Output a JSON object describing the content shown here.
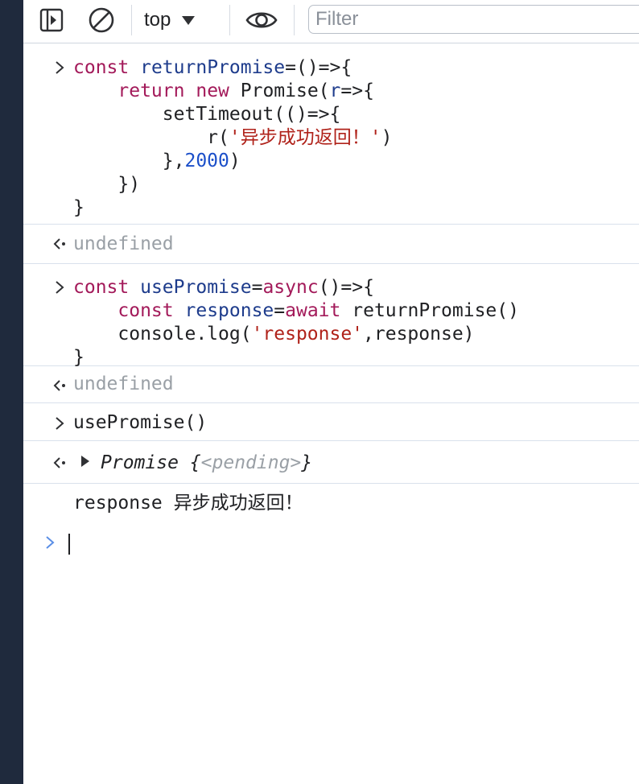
{
  "toolbar": {
    "context_label": "top",
    "filter_placeholder": "Filter",
    "icons": [
      "sidebar-toggle-icon",
      "clear-console-icon",
      "dropdown-triangle-icon",
      "eye-icon"
    ]
  },
  "console": {
    "entries": [
      {
        "kind": "input",
        "lines": [
          [
            "const",
            "returnPromise",
            "=()=>{"
          ],
          [
            "return",
            "new",
            "Promise(",
            "r",
            "=>{"
          ],
          [
            "setTimeout(()=>{"
          ],
          [
            "r(",
            "'异步成功返回！'",
            ")"
          ],
          [
            "},",
            "2000",
            ")"
          ],
          [
            "})"
          ],
          [
            "}"
          ]
        ]
      },
      {
        "kind": "result",
        "text": "undefined"
      },
      {
        "kind": "input",
        "lines": [
          [
            "const",
            "usePromise",
            "=",
            "async",
            "()=>{"
          ],
          [
            "const",
            "response",
            "=",
            "await",
            "returnPromise()"
          ],
          [
            "console.log(",
            "'response'",
            ",response)"
          ],
          [
            "}"
          ]
        ]
      },
      {
        "kind": "result",
        "text": "undefined"
      },
      {
        "kind": "input",
        "lines": [
          [
            "usePromise()"
          ]
        ]
      },
      {
        "kind": "result",
        "object": {
          "name": "Promise",
          "open": "{",
          "state": "<pending>",
          "close": "}"
        }
      },
      {
        "kind": "log",
        "label": "response",
        "value": "异步成功返回！"
      }
    ]
  },
  "colors": {
    "keyword": "#a31a5a",
    "identifier": "#1e3c8c",
    "number": "#1b4fc9",
    "string": "#b0221a",
    "muted": "#9aa0a6",
    "prompt_active": "#5a8ee6",
    "sidebar_strip": "#1f2a3d"
  }
}
